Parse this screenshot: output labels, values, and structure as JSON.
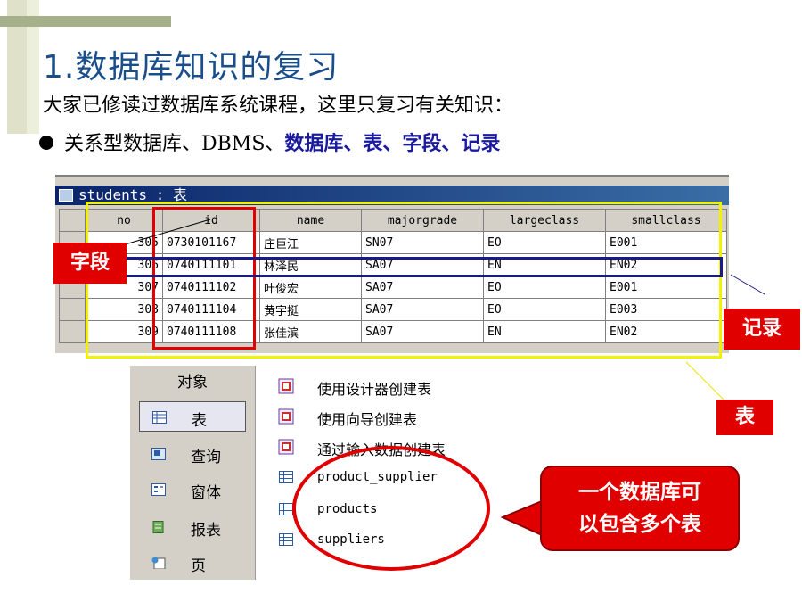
{
  "title": "1.数据库知识的复习",
  "intro": "大家已修读过数据库系统课程，这里只复习有关知识：",
  "bullet": {
    "prefix": "关系型数据库、DBMS、",
    "highlight": "数据库、表、字段、记录"
  },
  "students_window": {
    "title": "students : 表",
    "columns": [
      "no",
      "id",
      "name",
      "majorgrade",
      "largeclass",
      "smallclass"
    ],
    "rows": [
      {
        "no": "305",
        "id": "0730101167",
        "name": "庄巨江",
        "majorgrade": "SN07",
        "largeclass": "EO",
        "smallclass": "E001"
      },
      {
        "no": "306",
        "id": "0740111101",
        "name": "林泽民",
        "majorgrade": "SA07",
        "largeclass": "EN",
        "smallclass": "EN02"
      },
      {
        "no": "307",
        "id": "0740111102",
        "name": "叶俊宏",
        "majorgrade": "SA07",
        "largeclass": "EO",
        "smallclass": "E001"
      },
      {
        "no": "308",
        "id": "0740111104",
        "name": "黄宇挺",
        "majorgrade": "SA07",
        "largeclass": "EO",
        "smallclass": "E003"
      },
      {
        "no": "309",
        "id": "0740111108",
        "name": "张佳滨",
        "majorgrade": "SA07",
        "largeclass": "EN",
        "smallclass": "EN02"
      }
    ]
  },
  "labels": {
    "field": "字段",
    "record": "记录",
    "table": "表"
  },
  "objects_panel": {
    "header": "对象",
    "items": [
      {
        "label": "表",
        "icon": "table-icon"
      },
      {
        "label": "查询",
        "icon": "query-icon"
      },
      {
        "label": "窗体",
        "icon": "form-icon"
      },
      {
        "label": "报表",
        "icon": "report-icon"
      },
      {
        "label": "页",
        "icon": "page-icon"
      }
    ],
    "list": [
      {
        "label": "使用设计器创建表",
        "icon": "wizard-icon"
      },
      {
        "label": "使用向导创建表",
        "icon": "wizard-icon"
      },
      {
        "label": "通过输入数据创建表",
        "icon": "wizard-icon"
      },
      {
        "label": "product_supplier",
        "icon": "table-icon"
      },
      {
        "label": "products",
        "icon": "table-icon"
      },
      {
        "label": "suppliers",
        "icon": "table-icon"
      }
    ]
  },
  "callout": {
    "line1": "一个数据库可",
    "line2": "以包含多个表"
  },
  "colors": {
    "title": "#1a4e8a",
    "highlight": "#1a1a9e",
    "label_red": "#e00000",
    "yellow_box": "#f2f200",
    "record_box": "#1a1a8a"
  }
}
